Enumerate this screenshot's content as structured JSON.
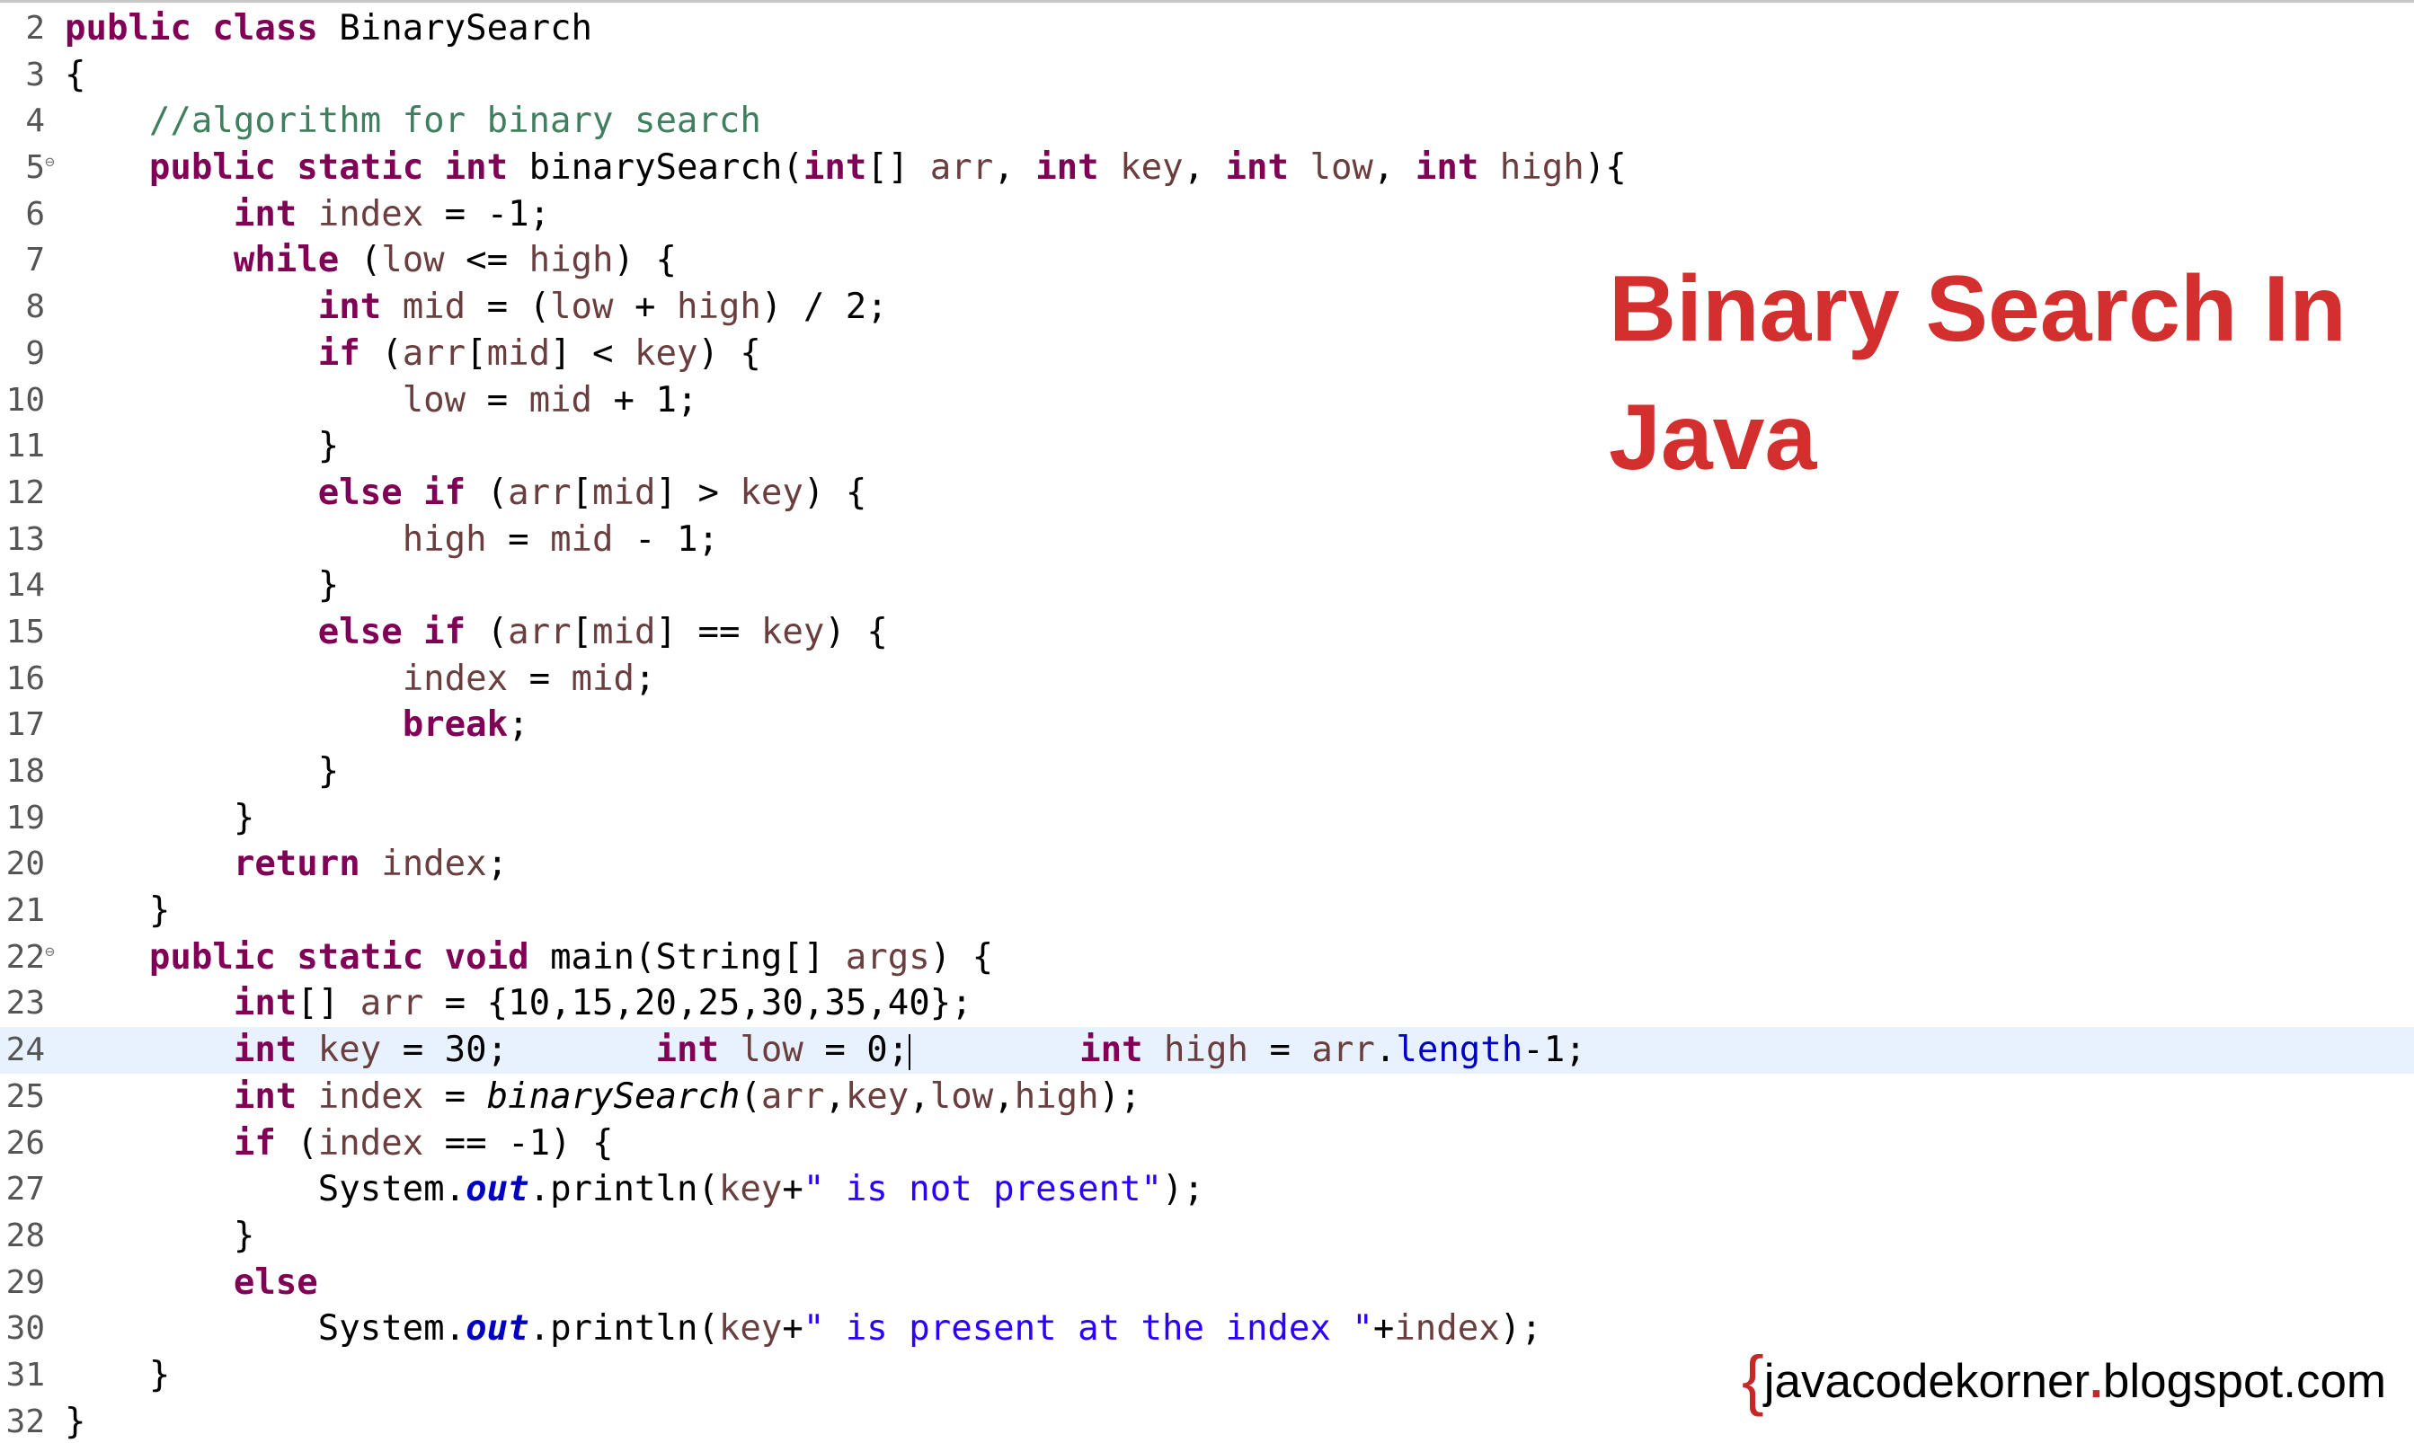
{
  "editor": {
    "current_line": "24",
    "lines": [
      {
        "n": "2"
      },
      {
        "n": "3"
      },
      {
        "n": "4"
      },
      {
        "n": "5"
      },
      {
        "n": "6"
      },
      {
        "n": "7"
      },
      {
        "n": "8"
      },
      {
        "n": "9"
      },
      {
        "n": "10"
      },
      {
        "n": "11"
      },
      {
        "n": "12"
      },
      {
        "n": "13"
      },
      {
        "n": "14"
      },
      {
        "n": "15"
      },
      {
        "n": "16"
      },
      {
        "n": "17"
      },
      {
        "n": "18"
      },
      {
        "n": "19"
      },
      {
        "n": "20"
      },
      {
        "n": "21"
      },
      {
        "n": "22"
      },
      {
        "n": "23"
      },
      {
        "n": "24"
      },
      {
        "n": "25"
      },
      {
        "n": "26"
      },
      {
        "n": "27"
      },
      {
        "n": "28"
      },
      {
        "n": "29"
      },
      {
        "n": "30"
      },
      {
        "n": "31"
      },
      {
        "n": "32"
      }
    ],
    "code": {
      "l2": {
        "kw1": "public",
        "kw2": "class",
        "name": "BinarySearch"
      },
      "l3": {
        "text": "{"
      },
      "l4": {
        "comment": "//algorithm for binary search"
      },
      "l5": {
        "kw1": "public",
        "kw2": "static",
        "kw3": "int",
        "name": "binarySearch(",
        "kw4": "int",
        "p1": "[] ",
        "v1": "arr",
        "c1": ", ",
        "kw5": "int",
        "v2": " key",
        "c2": ", ",
        "kw6": "int",
        "v3": " low",
        "c3": ", ",
        "kw7": "int",
        "v4": " high",
        "end": "){"
      },
      "l6": {
        "kw": "int",
        "v": " index",
        "rest": " = -1;"
      },
      "l7": {
        "kw": "while",
        "p1": " (",
        "v1": "low",
        "op": " <= ",
        "v2": "high",
        "end": ") {"
      },
      "l8": {
        "kw": "int",
        "v1": " mid",
        "p1": " = (",
        "v2": "low",
        "p2": " + ",
        "v3": "high",
        "end": ") / 2;"
      },
      "l9": {
        "kw": "if",
        "p1": " (",
        "v1": "arr",
        "p2": "[",
        "v2": "mid",
        "p3": "] < ",
        "v3": "key",
        "end": ") {"
      },
      "l10": {
        "v1": "low",
        "p1": " = ",
        "v2": "mid",
        "end": " + 1;"
      },
      "l11": {
        "text": "}"
      },
      "l12": {
        "kw": "else if",
        "p1": " (",
        "v1": "arr",
        "p2": "[",
        "v2": "mid",
        "p3": "] > ",
        "v3": "key",
        "end": ") {"
      },
      "l13": {
        "v1": "high",
        "p1": " = ",
        "v2": "mid",
        "end": " - 1;"
      },
      "l14": {
        "text": "}"
      },
      "l15": {
        "kw": "else if",
        "p1": " (",
        "v1": "arr",
        "p2": "[",
        "v2": "mid",
        "p3": "] == ",
        "v3": "key",
        "end": ") {"
      },
      "l16": {
        "v1": "index",
        "p1": " = ",
        "v2": "mid",
        "end": ";"
      },
      "l17": {
        "kw": "break",
        "end": ";"
      },
      "l18": {
        "text": "}"
      },
      "l19": {
        "text": "}"
      },
      "l20": {
        "kw": "return",
        "v": " index",
        "end": ";"
      },
      "l21": {
        "text": "}"
      },
      "l22": {
        "kw1": "public",
        "kw2": "static",
        "kw3": "void",
        "name": " main(String[] ",
        "v": "args",
        "end": ") {"
      },
      "l23": {
        "kw": "int",
        "p1": "[] ",
        "v": "arr",
        "end": " = {10,15,20,25,30,35,40};"
      },
      "l24": {
        "kw1": "int",
        "v1": " key",
        "p1": " = 30;",
        "gap1": "       ",
        "kw2": "int",
        "v2": " low",
        "p2": " = 0;",
        "gap2": "        ",
        "kw3": "int",
        "v3": " high",
        "p3": " = ",
        "v4": "arr",
        "p4": ".",
        "fld": "length",
        "end": "-1;"
      },
      "l25": {
        "kw": "int",
        "v1": " index",
        "p1": " = ",
        "m": "binarySearch",
        "p2": "(",
        "v2": "arr",
        "c1": ",",
        "v3": "key",
        "c2": ",",
        "v4": "low",
        "c3": ",",
        "v5": "high",
        "end": ");"
      },
      "l26": {
        "kw": "if",
        "p1": " (",
        "v": "index",
        "end": " == -1) {"
      },
      "l27": {
        "cls": "System.",
        "fld": "out",
        "p1": ".println(",
        "v": "key",
        "p2": "+",
        "str": "\" is not present\"",
        "end": ");"
      },
      "l28": {
        "text": "}"
      },
      "l29": {
        "kw": "else"
      },
      "l30": {
        "cls": "System.",
        "fld": "out",
        "p1": ".println(",
        "v1": "key",
        "p2": "+",
        "str": "\" is present at the index \"",
        "p3": "+",
        "v2": "index",
        "end": ");"
      },
      "l31": {
        "text": "}"
      },
      "l32": {
        "text": "}"
      }
    }
  },
  "overlay": {
    "title_line1": "Binary Search In",
    "title_line2": "Java",
    "watermark_brace": "{",
    "watermark_pre": "javacodekorner",
    "watermark_dot": ".",
    "watermark_post": "blogspot.com",
    "title_color": "#d32f2f"
  },
  "colors": {
    "keyword": "#7f0055",
    "comment": "#3f7f5f",
    "string": "#2a00ff",
    "field": "#0000c0",
    "variable": "#6a3e3e",
    "current_line_bg": "#e8f2fe"
  }
}
